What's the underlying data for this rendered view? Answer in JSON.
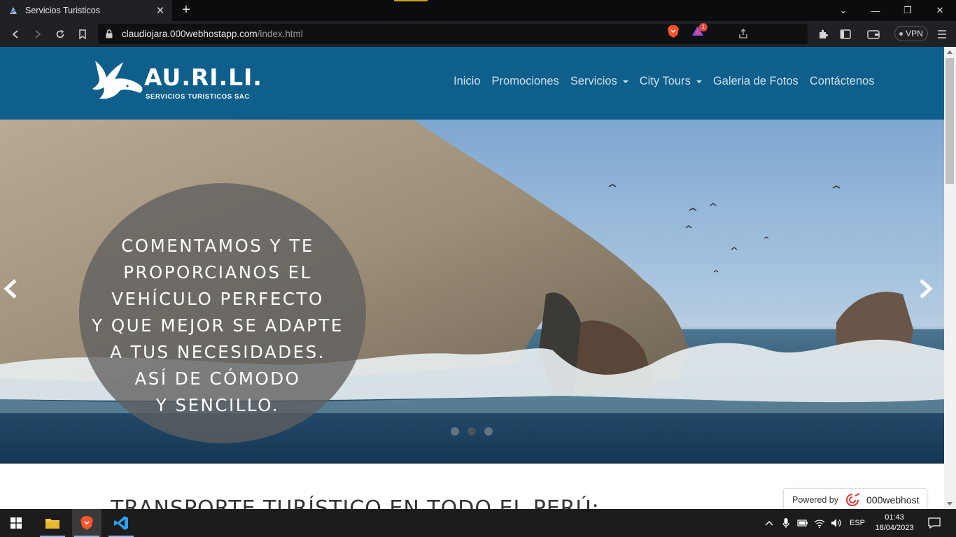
{
  "browser": {
    "tab_title": "Servicios Turisticos",
    "tab_close": "✕",
    "new_tab": "+",
    "url_host": "claudiojara.000webhostapp.com",
    "url_path": "/index.html",
    "rewards_badge": "1",
    "vpn_label": "VPN",
    "window_controls": {
      "minimize": "—",
      "restore": "❐",
      "close": "✕",
      "tabs_menu": "⌄"
    }
  },
  "site": {
    "logo_wordmark": "AU.RI.LI.",
    "logo_tagline": "SERVICIOS TURISTICOS SAC",
    "nav": [
      {
        "label": "Inicio",
        "dropdown": false
      },
      {
        "label": "Promociones",
        "dropdown": false
      },
      {
        "label": "Servicios",
        "dropdown": true
      },
      {
        "label": "City Tours",
        "dropdown": true
      },
      {
        "label": "Galeria de Fotos",
        "dropdown": false
      },
      {
        "label": "Contáctenos",
        "dropdown": false
      }
    ],
    "hero_caption": [
      "COMENTAMOS Y TE",
      "PROPORCIANOS EL",
      "VEHÍCULO PERFECTO",
      "Y QUE MEJOR SE ADAPTE",
      "A TUS NECESIDADES.",
      "ASÍ DE CÓMODO",
      "Y SENCILLO."
    ],
    "carousel": {
      "slides": 3,
      "active_index": 1
    },
    "section_title": "TRANSPORTE TURÍSTICO EN TODO EL PERÚ:",
    "powered_label": "Powered by",
    "powered_brand": "000webhost"
  },
  "taskbar": {
    "language": "ESP",
    "time": "01:43",
    "date": "18/04/2023"
  },
  "colors": {
    "header_blue": "#0e5f8c",
    "browser_dark": "#1f2125",
    "taskbar": "#1c1c1c"
  }
}
